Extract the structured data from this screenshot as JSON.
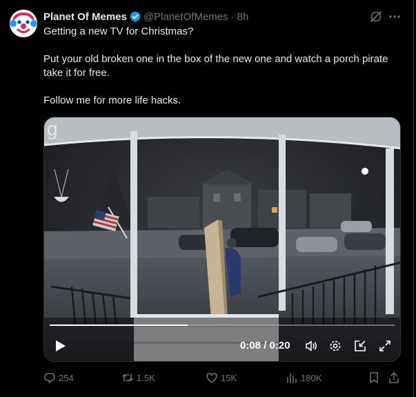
{
  "tweet": {
    "display_name": "Planet Of Memes",
    "handle": "@PlanetOfMemes",
    "separator": "·",
    "time": "8h",
    "text_line1": "Getting a new TV for Christmas?",
    "text_line2": "Put your old broken one in the box of the new one and watch a porch pirate take it for free.",
    "text_line3": "Follow me for more life hacks."
  },
  "video": {
    "time_readout": "0:08 / 0:20",
    "progress_fraction": 0.4,
    "watermark": "g"
  },
  "actions": {
    "replies": "254",
    "reposts": "1.5K",
    "likes": "15K",
    "views": "180K"
  },
  "colors": {
    "background": "#000000",
    "text": "#e7e9ea",
    "muted": "#71767b",
    "verified_blue": "#1d9bf0"
  },
  "icons": [
    "verified-badge-icon",
    "grok-icon",
    "more-icon",
    "play-icon",
    "volume-icon",
    "settings-icon",
    "minimize-icon",
    "fullscreen-icon",
    "reply-icon",
    "repost-icon",
    "like-icon",
    "views-icon",
    "bookmark-icon",
    "share-icon"
  ]
}
